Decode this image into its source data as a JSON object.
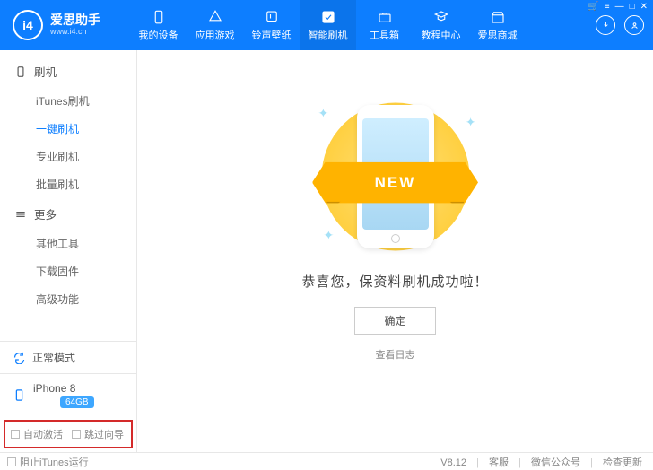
{
  "app": {
    "name": "爱思助手",
    "site": "www.i4.cn",
    "logo_text": "i4"
  },
  "nav": {
    "items": [
      {
        "name": "device",
        "label": "我的设备"
      },
      {
        "name": "apps",
        "label": "应用游戏"
      },
      {
        "name": "ringtone",
        "label": "铃声壁纸"
      },
      {
        "name": "flash",
        "label": "智能刷机",
        "active": true
      },
      {
        "name": "toolbox",
        "label": "工具箱"
      },
      {
        "name": "tutorial",
        "label": "教程中心"
      },
      {
        "name": "store",
        "label": "爱思商城"
      }
    ]
  },
  "sidebar": {
    "groups": [
      {
        "title": "刷机",
        "items": [
          {
            "key": "itunes_flash",
            "label": "iTunes刷机"
          },
          {
            "key": "oneclick",
            "label": "一键刷机",
            "active": true
          },
          {
            "key": "pro",
            "label": "专业刷机"
          },
          {
            "key": "batch",
            "label": "批量刷机"
          }
        ]
      },
      {
        "title": "更多",
        "items": [
          {
            "key": "other_tools",
            "label": "其他工具"
          },
          {
            "key": "download_fw",
            "label": "下载固件"
          },
          {
            "key": "advanced",
            "label": "高级功能"
          }
        ]
      }
    ],
    "mode_label": "正常模式",
    "device": {
      "name": "iPhone 8",
      "capacity": "64GB"
    },
    "options": {
      "auto_activate": "自动激活",
      "skip_setup": "跳过向导"
    }
  },
  "main": {
    "ribbon_text": "NEW",
    "success_text": "恭喜您，保资料刷机成功啦！",
    "ok_button": "确定",
    "view_log": "查看日志"
  },
  "footer": {
    "block_itunes": "阻止iTunes运行",
    "version": "V8.12",
    "links": {
      "service": "客服",
      "wechat": "微信公众号",
      "update": "检查更新"
    }
  }
}
